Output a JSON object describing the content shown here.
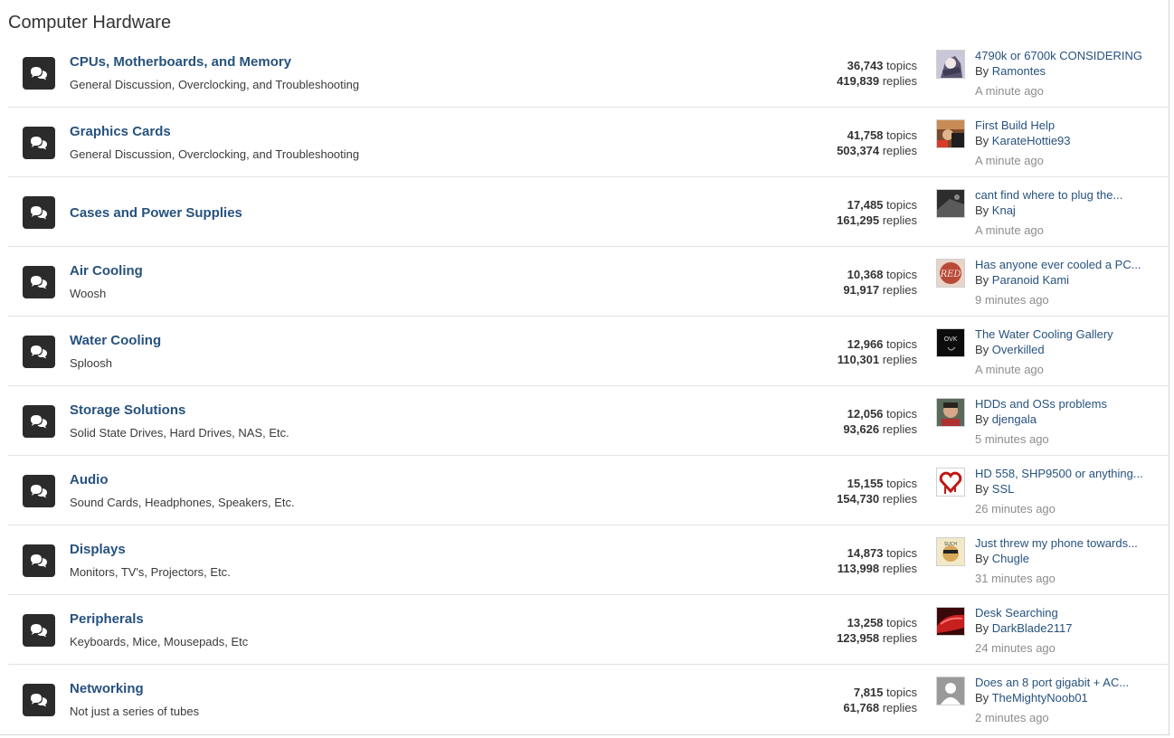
{
  "section_title": "Computer Hardware",
  "labels": {
    "topics": "topics",
    "replies": "replies",
    "by": "By"
  },
  "colors": {
    "link": "#27527e",
    "icon_bg": "#2b2b2b",
    "muted": "#8d8d8d"
  },
  "forums": [
    {
      "title": "CPUs, Motherboards, and Memory",
      "description": "General Discussion, Overclocking, and Troubleshooting",
      "topics": "36,743",
      "replies": "419,839",
      "last_post": {
        "title": "4790k or 6700k CONSIDERING",
        "author": "Ramontes",
        "time": "A minute ago",
        "avatar_icon": "anime-avatar"
      }
    },
    {
      "title": "Graphics Cards",
      "description": "General Discussion, Overclocking, and Troubleshooting",
      "topics": "41,758",
      "replies": "503,374",
      "last_post": {
        "title": "First Build Help",
        "author": "KarateHottie93",
        "time": "A minute ago",
        "avatar_icon": "photo-avatar"
      }
    },
    {
      "title": "Cases and Power Supplies",
      "description": "",
      "topics": "17,485",
      "replies": "161,295",
      "last_post": {
        "title": "cant find where to plug the...",
        "author": "Knaj",
        "time": "A minute ago",
        "avatar_icon": "dark-avatar"
      }
    },
    {
      "title": "Air Cooling",
      "description": "Woosh",
      "topics": "10,368",
      "replies": "91,917",
      "last_post": {
        "title": "Has anyone ever cooled a PC...",
        "author": "Paranoid Kami",
        "time": "9 minutes ago",
        "avatar_icon": "red-logo-avatar"
      }
    },
    {
      "title": "Water Cooling",
      "description": "Sploosh",
      "topics": "12,966",
      "replies": "110,301",
      "last_post": {
        "title": "The Water Cooling Gallery",
        "author": "Overkilled",
        "time": "A minute ago",
        "avatar_icon": "black-text-avatar"
      }
    },
    {
      "title": "Storage Solutions",
      "description": "Solid State Drives, Hard Drives, NAS, Etc.",
      "topics": "12,056",
      "replies": "93,626",
      "last_post": {
        "title": "HDDs and OSs problems",
        "author": "djengala",
        "time": "5 minutes ago",
        "avatar_icon": "face-avatar"
      }
    },
    {
      "title": "Audio",
      "description": "Sound Cards, Headphones, Speakers, Etc.",
      "topics": "15,155",
      "replies": "154,730",
      "last_post": {
        "title": "HD 558, SHP9500 or anything...",
        "author": "SSL",
        "time": "26 minutes ago",
        "avatar_icon": "heart-avatar"
      }
    },
    {
      "title": "Displays",
      "description": "Monitors, TV's, Projectors, Etc.",
      "topics": "14,873",
      "replies": "113,998",
      "last_post": {
        "title": "Just threw my phone towards...",
        "author": "Chugle",
        "time": "31 minutes ago",
        "avatar_icon": "doge-avatar"
      }
    },
    {
      "title": "Peripherals",
      "description": "Keyboards, Mice, Mousepads, Etc",
      "topics": "13,258",
      "replies": "123,958",
      "last_post": {
        "title": "Desk Searching",
        "author": "DarkBlade2117",
        "time": "24 minutes ago",
        "avatar_icon": "red-car-avatar"
      }
    },
    {
      "title": "Networking",
      "description": "Not just a series of tubes",
      "topics": "7,815",
      "replies": "61,768",
      "last_post": {
        "title": "Does an 8 port gigabit + AC...",
        "author": "TheMightyNoob01",
        "time": "2 minutes ago",
        "avatar_icon": "default-user-avatar"
      }
    }
  ]
}
